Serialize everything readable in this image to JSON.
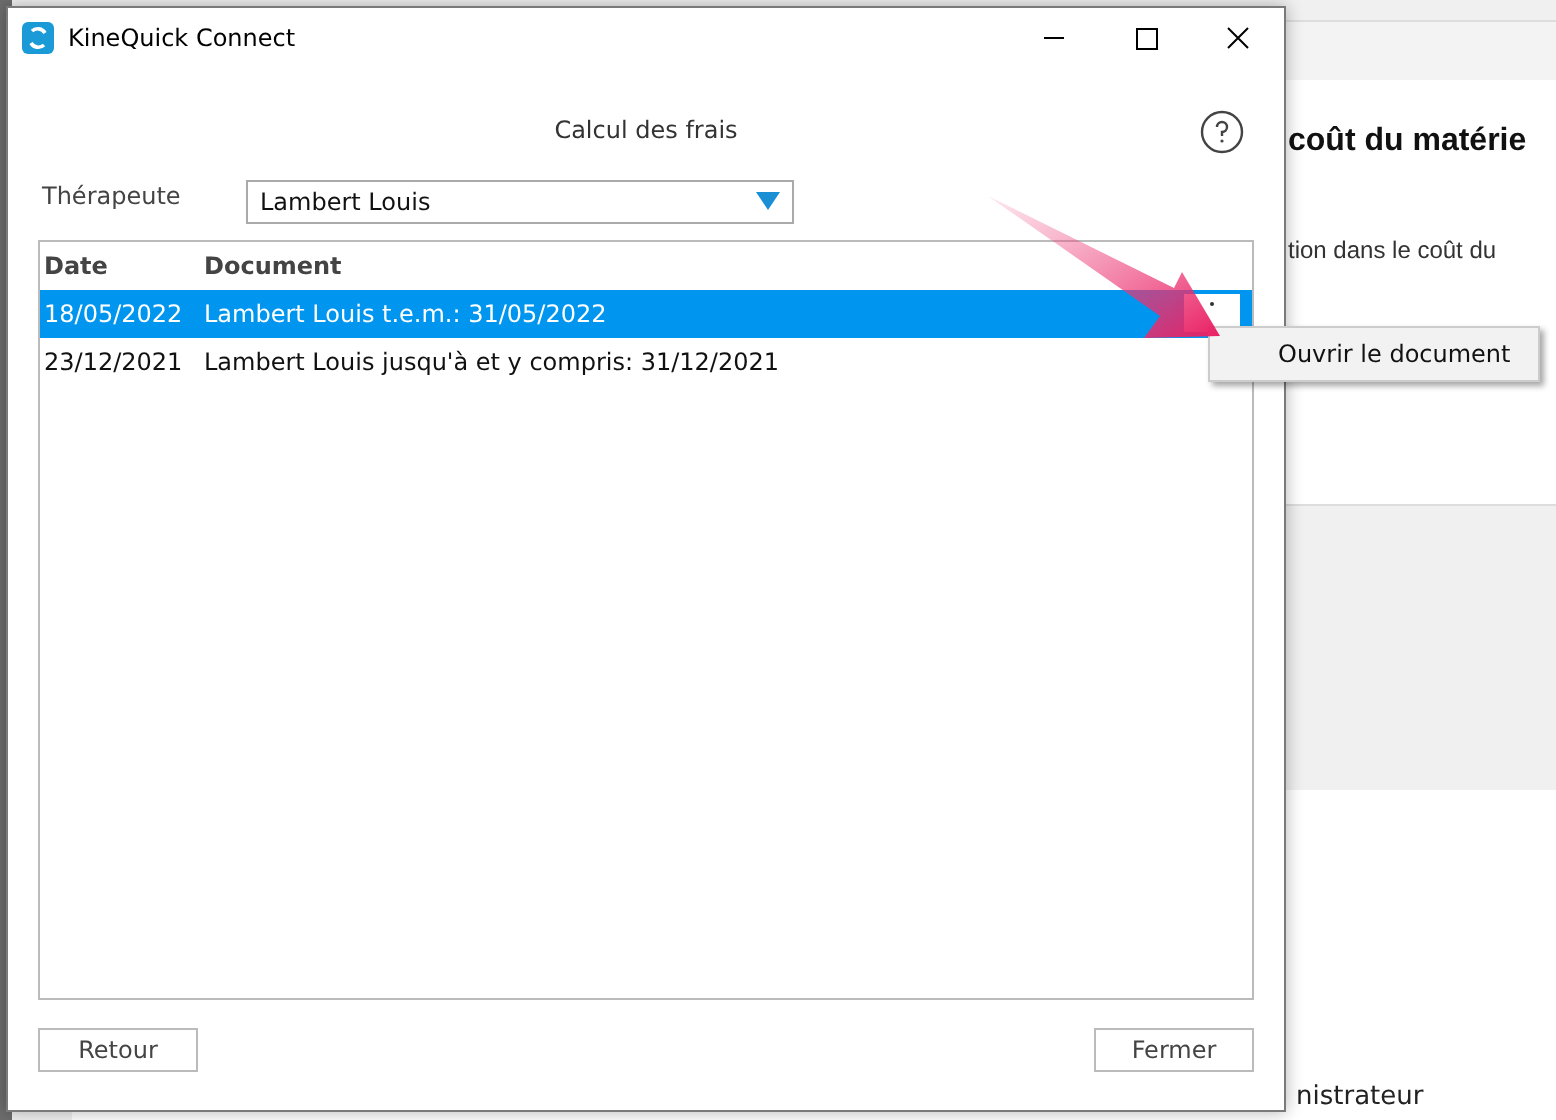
{
  "background_app": {
    "heading": "coût du matérie",
    "text": "tion dans le coût du",
    "footer_text": "nistrateur"
  },
  "window": {
    "title": "KineQuick Connect"
  },
  "dialog": {
    "heading": "Calcul des frais",
    "therapist": {
      "label": "Thérapeute",
      "value": "Lambert Louis"
    },
    "table": {
      "columns": [
        "Date",
        "Document"
      ],
      "rows": [
        {
          "date": "18/05/2022",
          "document": "Lambert Louis t.e.m.: 31/05/2022",
          "selected": true
        },
        {
          "date": "23/12/2021",
          "document": "Lambert Louis jusqu'à et y compris: 31/12/2021",
          "selected": false
        }
      ]
    },
    "context_menu": {
      "items": [
        "Ouvrir le document"
      ]
    },
    "buttons": [
      "Retour",
      "Fermer"
    ]
  }
}
